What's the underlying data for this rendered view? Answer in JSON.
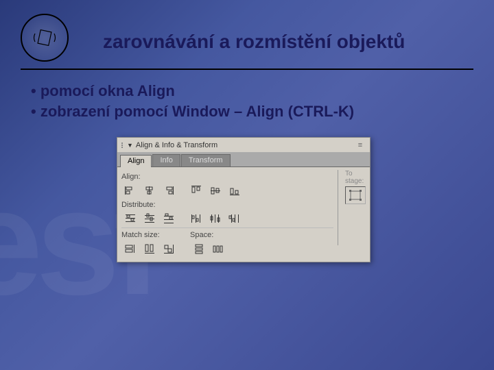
{
  "slide": {
    "title": "zarovnávání a rozmístění objektů",
    "bullets": [
      "pomocí okna Align",
      "zobrazení pomocí Window – Align (CTRL-K)"
    ],
    "watermark": "esf"
  },
  "panel": {
    "title": "Align & Info & Transform",
    "tabs": [
      "Align",
      "Info",
      "Transform"
    ],
    "active_tab": 0,
    "sections": {
      "align": "Align:",
      "distribute": "Distribute:",
      "match": "Match size:",
      "space": "Space:",
      "to_stage": "To\nstage:"
    }
  }
}
